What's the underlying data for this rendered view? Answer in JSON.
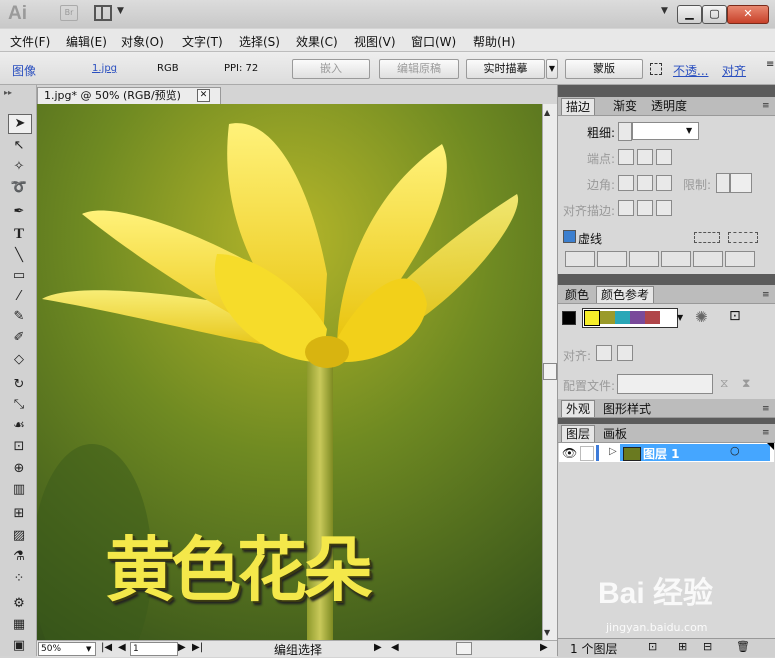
{
  "app": {
    "logo": "Ai",
    "bridge": "Br"
  },
  "menu": [
    "文件(F)",
    "编辑(E)",
    "对象(O)",
    "文字(T)",
    "选择(S)",
    "效果(C)",
    "视图(V)",
    "窗口(W)",
    "帮助(H)"
  ],
  "control": {
    "type": "图像",
    "file": "1.jpg",
    "mode": "RGB",
    "ppi": "PPI: 72",
    "embed": "嵌入",
    "edit_original": "编辑原稿",
    "live_trace": "实时描摹",
    "mask": "蒙版",
    "opacity": "不透...",
    "align": "对齐"
  },
  "document": {
    "tab_title": "1.jpg* @ 50% (RGB/预览)",
    "artwork_text": "黄色花朵"
  },
  "status": {
    "zoom": "50%",
    "page": "1",
    "tool": "编组选择"
  },
  "stroke_panel": {
    "tabs": [
      "描边",
      "渐变",
      "透明度"
    ],
    "weight": "粗细:",
    "cap": "端点:",
    "corner": "边角:",
    "limit": "限制:",
    "align_stroke": "对齐描边:",
    "dashed": "虚线"
  },
  "color_panel": {
    "tabs": [
      "颜色",
      "颜色参考"
    ],
    "swatches": [
      "#f6ee2a",
      "#9a9a2a",
      "#2aa7b7",
      "#7a4a9a",
      "#b0464a"
    ],
    "align_label": "对齐:",
    "profile_label": "配置文件:"
  },
  "appearance_panel": {
    "tabs": [
      "外观",
      "图形样式"
    ]
  },
  "layers_panel": {
    "tabs": [
      "图层",
      "画板"
    ],
    "layer_name": "图层 1",
    "count": "1 个图层"
  },
  "watermark": {
    "main": "Bai 经验",
    "sub": "jingyan.baidu.com"
  }
}
